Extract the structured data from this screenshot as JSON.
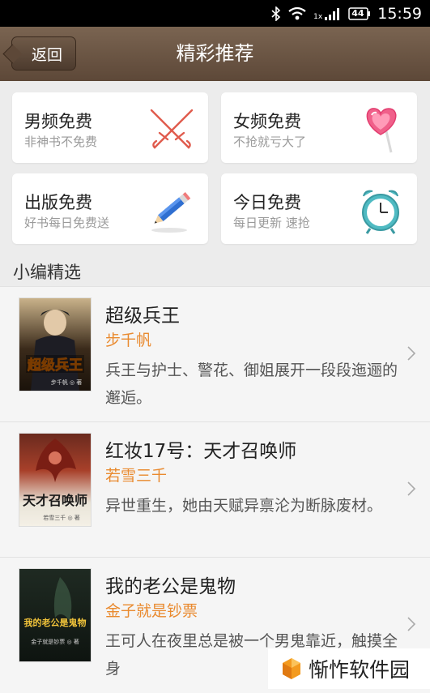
{
  "status_bar": {
    "time": "15:59",
    "battery": "44",
    "network": "1x"
  },
  "nav": {
    "back_label": "返回",
    "title": "精彩推荐"
  },
  "categories": [
    {
      "title": "男频免费",
      "subtitle": "非神书不免费",
      "icon": "crossed-swords-icon"
    },
    {
      "title": "女频免费",
      "subtitle": "不抢就亏大了",
      "icon": "heart-lollipop-icon"
    },
    {
      "title": "出版免费",
      "subtitle": "好书每日免费送",
      "icon": "pencil-icon"
    },
    {
      "title": "今日免费",
      "subtitle": "每日更新 速抢",
      "icon": "alarm-clock-icon"
    }
  ],
  "section_title": "小编精选",
  "books": [
    {
      "title": "超级兵王",
      "author": "步千帆",
      "desc": "兵王与护士、警花、御姐展开一段段迤逦的邂逅。",
      "cover_text": "超级兵王",
      "cover_author": "步千帆 ◎ 著"
    },
    {
      "title": "红妆17号：天才召唤师",
      "author": "若雪三千",
      "desc": "异世重生，她由天赋异禀沦为断脉废材。",
      "cover_text": "天才召唤师",
      "cover_author": "若雪三千 ◎ 著"
    },
    {
      "title": "我的老公是鬼物",
      "author": "金子就是钞票",
      "desc": "王可人在夜里总是被一个男鬼靠近，触摸全身",
      "cover_text": "我的老公是鬼物",
      "cover_author": "金子就是钞票 ◎ 著"
    }
  ],
  "watermark": "惭怍软件园",
  "colors": {
    "nav": "#6b5543",
    "author": "#e98a2f",
    "background": "#ececec"
  }
}
